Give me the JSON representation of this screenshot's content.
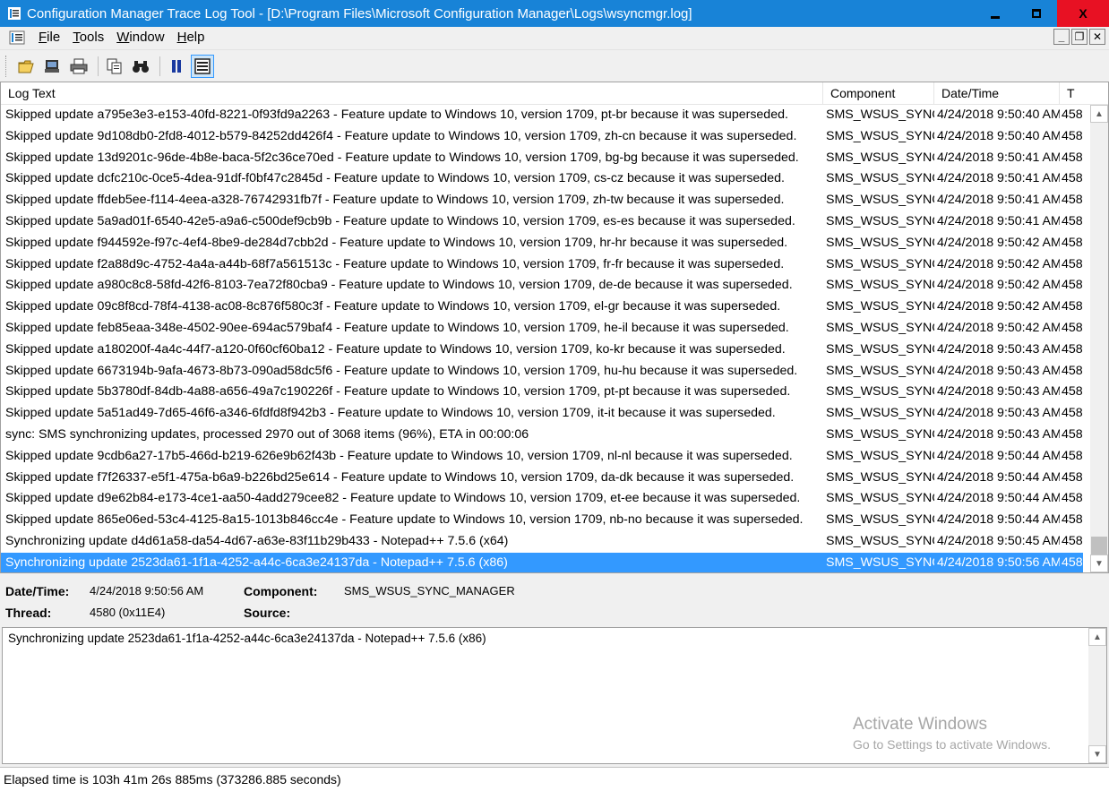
{
  "window": {
    "title": "Configuration Manager Trace Log Tool - [D:\\Program Files\\Microsoft Configuration Manager\\Logs\\wsyncmgr.log]",
    "close_glyph": "X"
  },
  "menu": {
    "file": "File",
    "tools": "Tools",
    "window": "Window",
    "help": "Help"
  },
  "mdi": {
    "min": "_",
    "restore": "❐",
    "close": "✕"
  },
  "toolbar": {
    "buttons": [
      "open-icon",
      "print-preview-icon",
      "print-icon",
      "copy-icon",
      "find-icon",
      "pause-icon",
      "details-pane-icon"
    ]
  },
  "columns": {
    "log_text": "Log Text",
    "component": "Component",
    "datetime": "Date/Time",
    "thread": "T"
  },
  "rows": [
    {
      "text": "Skipped update a795e3e3-e153-40fd-8221-0f93fd9a2263 - Feature update to Windows 10, version 1709, pt-br because it was superseded.",
      "component": "SMS_WSUS_SYNC",
      "datetime": "4/24/2018 9:50:40 AM",
      "thread": "458"
    },
    {
      "text": "Skipped update 9d108db0-2fd8-4012-b579-84252dd426f4 - Feature update to Windows 10, version 1709, zh-cn because it was superseded.",
      "component": "SMS_WSUS_SYNC",
      "datetime": "4/24/2018 9:50:40 AM",
      "thread": "458"
    },
    {
      "text": "Skipped update 13d9201c-96de-4b8e-baca-5f2c36ce70ed - Feature update to Windows 10, version 1709, bg-bg because it was superseded.",
      "component": "SMS_WSUS_SYNC",
      "datetime": "4/24/2018 9:50:41 AM",
      "thread": "458"
    },
    {
      "text": "Skipped update dcfc210c-0ce5-4dea-91df-f0bf47c2845d - Feature update to Windows 10, version 1709, cs-cz because it was superseded.",
      "component": "SMS_WSUS_SYNC",
      "datetime": "4/24/2018 9:50:41 AM",
      "thread": "458"
    },
    {
      "text": "Skipped update ffdeb5ee-f114-4eea-a328-76742931fb7f - Feature update to Windows 10, version 1709, zh-tw because it was superseded.",
      "component": "SMS_WSUS_SYNC",
      "datetime": "4/24/2018 9:50:41 AM",
      "thread": "458"
    },
    {
      "text": "Skipped update 5a9ad01f-6540-42e5-a9a6-c500def9cb9b - Feature update to Windows 10, version 1709, es-es because it was superseded.",
      "component": "SMS_WSUS_SYNC",
      "datetime": "4/24/2018 9:50:41 AM",
      "thread": "458"
    },
    {
      "text": "Skipped update f944592e-f97c-4ef4-8be9-de284d7cbb2d - Feature update to Windows 10, version 1709, hr-hr because it was superseded.",
      "component": "SMS_WSUS_SYNC",
      "datetime": "4/24/2018 9:50:42 AM",
      "thread": "458"
    },
    {
      "text": "Skipped update f2a88d9c-4752-4a4a-a44b-68f7a561513c - Feature update to Windows 10, version 1709, fr-fr because it was superseded.",
      "component": "SMS_WSUS_SYNC",
      "datetime": "4/24/2018 9:50:42 AM",
      "thread": "458"
    },
    {
      "text": "Skipped update a980c8c8-58fd-42f6-8103-7ea72f80cba9 - Feature update to Windows 10, version 1709, de-de because it was superseded.",
      "component": "SMS_WSUS_SYNC",
      "datetime": "4/24/2018 9:50:42 AM",
      "thread": "458"
    },
    {
      "text": "Skipped update 09c8f8cd-78f4-4138-ac08-8c876f580c3f - Feature update to Windows 10, version 1709, el-gr because it was superseded.",
      "component": "SMS_WSUS_SYNC",
      "datetime": "4/24/2018 9:50:42 AM",
      "thread": "458"
    },
    {
      "text": "Skipped update feb85eaa-348e-4502-90ee-694ac579baf4 - Feature update to Windows 10, version 1709, he-il because it was superseded.",
      "component": "SMS_WSUS_SYNC",
      "datetime": "4/24/2018 9:50:42 AM",
      "thread": "458"
    },
    {
      "text": "Skipped update a180200f-4a4c-44f7-a120-0f60cf60ba12 - Feature update to Windows 10, version 1709, ko-kr because it was superseded.",
      "component": "SMS_WSUS_SYNC",
      "datetime": "4/24/2018 9:50:43 AM",
      "thread": "458"
    },
    {
      "text": "Skipped update 6673194b-9afa-4673-8b73-090ad58dc5f6 - Feature update to Windows 10, version 1709, hu-hu because it was superseded.",
      "component": "SMS_WSUS_SYNC",
      "datetime": "4/24/2018 9:50:43 AM",
      "thread": "458"
    },
    {
      "text": "Skipped update 5b3780df-84db-4a88-a656-49a7c190226f - Feature update to Windows 10, version 1709, pt-pt because it was superseded.",
      "component": "SMS_WSUS_SYNC",
      "datetime": "4/24/2018 9:50:43 AM",
      "thread": "458"
    },
    {
      "text": "Skipped update 5a51ad49-7d65-46f6-a346-6fdfd8f942b3 - Feature update to Windows 10, version 1709, it-it because it was superseded.",
      "component": "SMS_WSUS_SYNC",
      "datetime": "4/24/2018 9:50:43 AM",
      "thread": "458"
    },
    {
      "text": "sync: SMS synchronizing updates, processed 2970 out of 3068 items (96%), ETA in 00:00:06",
      "component": "SMS_WSUS_SYNC",
      "datetime": "4/24/2018 9:50:43 AM",
      "thread": "458"
    },
    {
      "text": "Skipped update 9cdb6a27-17b5-466d-b219-626e9b62f43b - Feature update to Windows 10, version 1709, nl-nl because it was superseded.",
      "component": "SMS_WSUS_SYNC",
      "datetime": "4/24/2018 9:50:44 AM",
      "thread": "458"
    },
    {
      "text": "Skipped update f7f26337-e5f1-475a-b6a9-b226bd25e614 - Feature update to Windows 10, version 1709, da-dk because it was superseded.",
      "component": "SMS_WSUS_SYNC",
      "datetime": "4/24/2018 9:50:44 AM",
      "thread": "458"
    },
    {
      "text": "Skipped update d9e62b84-e173-4ce1-aa50-4add279cee82 - Feature update to Windows 10, version 1709, et-ee because it was superseded.",
      "component": "SMS_WSUS_SYNC",
      "datetime": "4/24/2018 9:50:44 AM",
      "thread": "458"
    },
    {
      "text": "Skipped update 865e06ed-53c4-4125-8a15-1013b846cc4e - Feature update to Windows 10, version 1709, nb-no because it was superseded.",
      "component": "SMS_WSUS_SYNC",
      "datetime": "4/24/2018 9:50:44 AM",
      "thread": "458"
    },
    {
      "text": "Synchronizing update d4d61a58-da54-4d67-a63e-83f11b29b433 - Notepad++ 7.5.6 (x64)",
      "component": "SMS_WSUS_SYNC",
      "datetime": "4/24/2018 9:50:45 AM",
      "thread": "458"
    },
    {
      "text": "Synchronizing update 2523da61-1f1a-4252-a44c-6ca3e24137da - Notepad++ 7.5.6 (x86)",
      "component": "SMS_WSUS_SYNC",
      "datetime": "4/24/2018 9:50:56 AM",
      "thread": "458",
      "selected": true
    }
  ],
  "details": {
    "datetime_label": "Date/Time:",
    "datetime_value": "4/24/2018 9:50:56 AM",
    "component_label": "Component:",
    "component_value": "SMS_WSUS_SYNC_MANAGER",
    "thread_label": "Thread:",
    "thread_value": "4580 (0x11E4)",
    "source_label": "Source:",
    "source_value": ""
  },
  "message": "Synchronizing update 2523da61-1f1a-4252-a44c-6ca3e24137da - Notepad++ 7.5.6 (x86)",
  "watermark": {
    "line1": "Activate Windows",
    "line2": "Go to Settings to activate Windows."
  },
  "status": "Elapsed time is 103h 41m 26s 885ms (373286.885 seconds)",
  "colors": {
    "titlebar": "#1883d7",
    "selection": "#3399ff",
    "close": "#e81123"
  },
  "scroll_arrows": {
    "up": "▲",
    "down": "▼"
  }
}
